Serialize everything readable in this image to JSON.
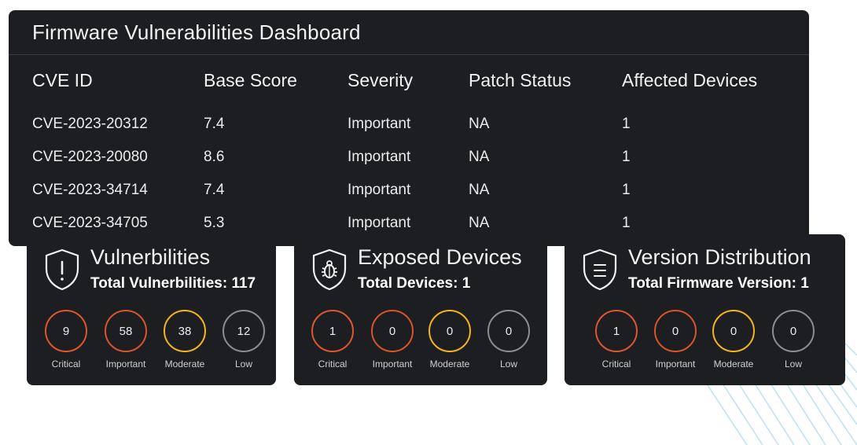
{
  "dashboard": {
    "title": "Firmware Vulnerabilities Dashboard",
    "columns": [
      "CVE ID",
      "Base Score",
      "Severity",
      "Patch Status",
      "Affected Devices"
    ],
    "rows": [
      [
        "CVE-2023-20312",
        "7.4",
        "Important",
        "NA",
        "1"
      ],
      [
        "CVE-2023-20080",
        "8.6",
        "Important",
        "NA",
        "1"
      ],
      [
        "CVE-2023-34714",
        "7.4",
        "Important",
        "NA",
        "1"
      ],
      [
        "CVE-2023-34705",
        "5.3",
        "Important",
        "NA",
        "1"
      ]
    ]
  },
  "severity_colors": {
    "Critical": "#e0552f",
    "Important": "#d9542b",
    "Moderate": "#f2b51d",
    "Low": "#8a8d91"
  },
  "cards": [
    {
      "title": "Vulnerbilities",
      "subtitle": "Total Vulnerbilities: 117",
      "icon": "shield-alert-icon",
      "stats": [
        {
          "label": "Critical",
          "value": "9"
        },
        {
          "label": "Important",
          "value": "58"
        },
        {
          "label": "Moderate",
          "value": "38"
        },
        {
          "label": "Low",
          "value": "12"
        }
      ]
    },
    {
      "title": "Exposed Devices",
      "subtitle": "Total Devices: 1",
      "icon": "shield-bug-icon",
      "stats": [
        {
          "label": "Critical",
          "value": "1"
        },
        {
          "label": "Important",
          "value": "0"
        },
        {
          "label": "Moderate",
          "value": "0"
        },
        {
          "label": "Low",
          "value": "0"
        }
      ]
    },
    {
      "title": "Version Distribution",
      "subtitle": "Total Firmware Version: 1",
      "icon": "shield-list-icon",
      "stats": [
        {
          "label": "Critical",
          "value": "1"
        },
        {
          "label": "Important",
          "value": "0"
        },
        {
          "label": "Moderate",
          "value": "0"
        },
        {
          "label": "Low",
          "value": "0"
        }
      ]
    }
  ]
}
